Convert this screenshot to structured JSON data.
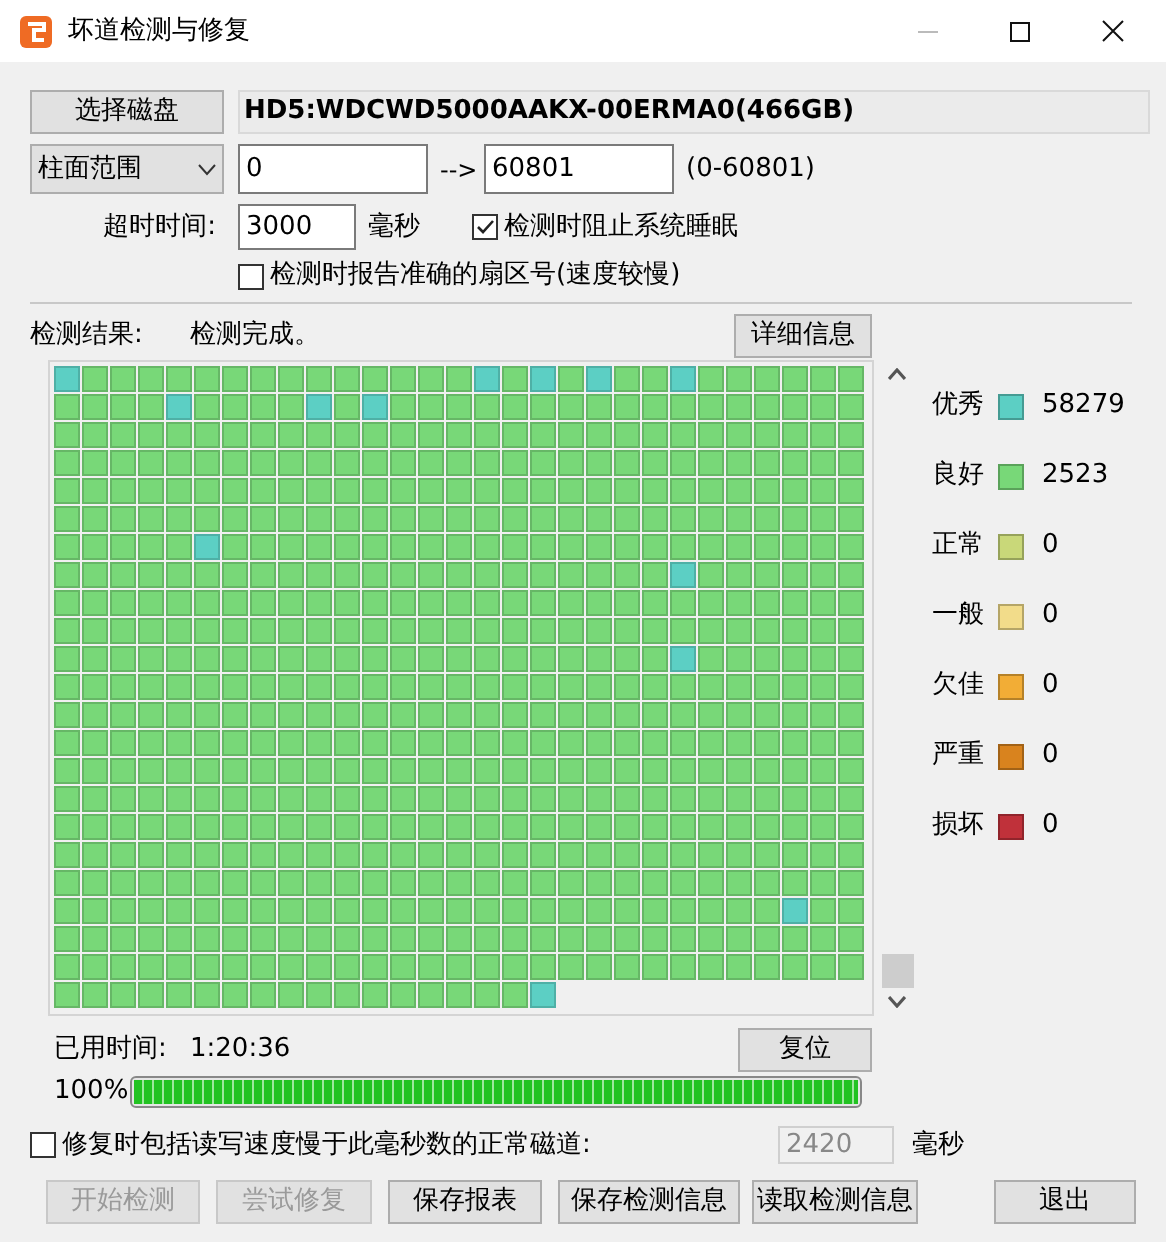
{
  "window": {
    "title": "坏道检测与修复"
  },
  "disk": {
    "button": "选择磁盘",
    "name": "HD5:WDCWD5000AAKX-00ERMA0(466GB)"
  },
  "range": {
    "mode": "柱面范围",
    "from": "0",
    "arrow": "-->",
    "to": "60801",
    "hint": "(0-60801)"
  },
  "timeout": {
    "label": "超时时间:",
    "value": "3000",
    "unit": "毫秒"
  },
  "options": [
    {
      "label": "检测时阻止系统睡眠",
      "checked": true
    },
    {
      "label": "检测时报告准确的扇区号(速度较慢)",
      "checked": false
    }
  ],
  "result": {
    "label": "检测结果:",
    "status": "检测完成。",
    "details_button": "详细信息"
  },
  "legend": [
    {
      "label": "优秀",
      "count": "58279",
      "color": "#5ccfc4"
    },
    {
      "label": "良好",
      "count": "2523",
      "color": "#78d878"
    },
    {
      "label": "正常",
      "count": "0",
      "color": "#c9d879"
    },
    {
      "label": "一般",
      "count": "0",
      "color": "#f2dc8a"
    },
    {
      "label": "欠佳",
      "count": "0",
      "color": "#f2ad36"
    },
    {
      "label": "严重",
      "count": "0",
      "color": "#d9831e"
    },
    {
      "label": "损坏",
      "count": "0",
      "color": "#c0313a"
    }
  ],
  "map_rows": [
    [
      {
        "color": "#5ccfc4"
      },
      {
        "color": "#78d878"
      },
      {
        "color": "#78d878"
      },
      {
        "color": "#78d878"
      },
      {
        "color": "#78d878"
      },
      {
        "color": "#78d878"
      },
      {
        "color": "#78d878"
      },
      {
        "color": "#78d878"
      },
      {
        "color": "#78d878"
      },
      {
        "color": "#78d878"
      },
      {
        "color": "#78d878"
      },
      {
        "color": "#78d878"
      },
      {
        "color": "#78d878"
      },
      {
        "color": "#78d878"
      },
      {
        "color": "#78d878"
      },
      {
        "color": "#5ccfc4"
      },
      {
        "color": "#78d878"
      },
      {
        "color": "#5ccfc4"
      },
      {
        "color": "#78d878"
      },
      {
        "color": "#5ccfc4"
      },
      {
        "color": "#78d878"
      },
      {
        "color": "#78d878"
      },
      {
        "color": "#5ccfc4"
      },
      {
        "color": "#78d878"
      },
      {
        "color": "#78d878"
      },
      {
        "color": "#78d878"
      },
      {
        "color": "#78d878"
      },
      {
        "color": "#78d878"
      },
      {
        "color": "#78d878"
      }
    ],
    [
      {
        "color": "#78d878"
      },
      {
        "color": "#78d878"
      },
      {
        "color": "#78d878"
      },
      {
        "color": "#78d878"
      },
      {
        "color": "#5ccfc4"
      },
      {
        "color": "#78d878"
      },
      {
        "color": "#78d878"
      },
      {
        "color": "#78d878"
      },
      {
        "color": "#78d878"
      },
      {
        "color": "#5ccfc4"
      },
      {
        "color": "#78d878"
      },
      {
        "color": "#5ccfc4"
      },
      {
        "color": "#78d878"
      },
      {
        "color": "#78d878"
      },
      {
        "color": "#78d878"
      },
      {
        "color": "#78d878"
      },
      {
        "color": "#78d878"
      },
      {
        "color": "#78d878"
      },
      {
        "color": "#78d878"
      },
      {
        "color": "#78d878"
      },
      {
        "color": "#78d878"
      },
      {
        "color": "#78d878"
      },
      {
        "color": "#78d878"
      },
      {
        "color": "#78d878"
      },
      {
        "color": "#78d878"
      },
      {
        "color": "#78d878"
      },
      {
        "color": "#78d878"
      },
      {
        "color": "#78d878"
      },
      {
        "color": "#78d878"
      }
    ],
    [
      {
        "color": "#78d878"
      },
      {
        "color": "#78d878"
      },
      {
        "color": "#78d878"
      },
      {
        "color": "#78d878"
      },
      {
        "color": "#78d878"
      },
      {
        "color": "#78d878"
      },
      {
        "color": "#78d878"
      },
      {
        "color": "#78d878"
      },
      {
        "color": "#78d878"
      },
      {
        "color": "#78d878"
      },
      {
        "color": "#78d878"
      },
      {
        "color": "#78d878"
      },
      {
        "color": "#78d878"
      },
      {
        "color": "#78d878"
      },
      {
        "color": "#78d878"
      },
      {
        "color": "#78d878"
      },
      {
        "color": "#78d878"
      },
      {
        "color": "#78d878"
      },
      {
        "color": "#78d878"
      },
      {
        "color": "#78d878"
      },
      {
        "color": "#78d878"
      },
      {
        "color": "#78d878"
      },
      {
        "color": "#78d878"
      },
      {
        "color": "#78d878"
      },
      {
        "color": "#78d878"
      },
      {
        "color": "#78d878"
      },
      {
        "color": "#78d878"
      },
      {
        "color": "#78d878"
      },
      {
        "color": "#78d878"
      }
    ],
    [
      {
        "color": "#78d878"
      },
      {
        "color": "#78d878"
      },
      {
        "color": "#78d878"
      },
      {
        "color": "#78d878"
      },
      {
        "color": "#78d878"
      },
      {
        "color": "#78d878"
      },
      {
        "color": "#78d878"
      },
      {
        "color": "#78d878"
      },
      {
        "color": "#78d878"
      },
      {
        "color": "#78d878"
      },
      {
        "color": "#78d878"
      },
      {
        "color": "#78d878"
      },
      {
        "color": "#78d878"
      },
      {
        "color": "#78d878"
      },
      {
        "color": "#78d878"
      },
      {
        "color": "#78d878"
      },
      {
        "color": "#78d878"
      },
      {
        "color": "#78d878"
      },
      {
        "color": "#78d878"
      },
      {
        "color": "#78d878"
      },
      {
        "color": "#78d878"
      },
      {
        "color": "#78d878"
      },
      {
        "color": "#78d878"
      },
      {
        "color": "#78d878"
      },
      {
        "color": "#78d878"
      },
      {
        "color": "#78d878"
      },
      {
        "color": "#78d878"
      },
      {
        "color": "#78d878"
      },
      {
        "color": "#78d878"
      }
    ],
    [
      {
        "color": "#78d878"
      },
      {
        "color": "#78d878"
      },
      {
        "color": "#78d878"
      },
      {
        "color": "#78d878"
      },
      {
        "color": "#78d878"
      },
      {
        "color": "#78d878"
      },
      {
        "color": "#78d878"
      },
      {
        "color": "#78d878"
      },
      {
        "color": "#78d878"
      },
      {
        "color": "#78d878"
      },
      {
        "color": "#78d878"
      },
      {
        "color": "#78d878"
      },
      {
        "color": "#78d878"
      },
      {
        "color": "#78d878"
      },
      {
        "color": "#78d878"
      },
      {
        "color": "#78d878"
      },
      {
        "color": "#78d878"
      },
      {
        "color": "#78d878"
      },
      {
        "color": "#78d878"
      },
      {
        "color": "#78d878"
      },
      {
        "color": "#78d878"
      },
      {
        "color": "#78d878"
      },
      {
        "color": "#78d878"
      },
      {
        "color": "#78d878"
      },
      {
        "color": "#78d878"
      },
      {
        "color": "#78d878"
      },
      {
        "color": "#78d878"
      },
      {
        "color": "#78d878"
      },
      {
        "color": "#78d878"
      }
    ],
    [
      {
        "color": "#78d878"
      },
      {
        "color": "#78d878"
      },
      {
        "color": "#78d878"
      },
      {
        "color": "#78d878"
      },
      {
        "color": "#78d878"
      },
      {
        "color": "#78d878"
      },
      {
        "color": "#78d878"
      },
      {
        "color": "#78d878"
      },
      {
        "color": "#78d878"
      },
      {
        "color": "#78d878"
      },
      {
        "color": "#78d878"
      },
      {
        "color": "#78d878"
      },
      {
        "color": "#78d878"
      },
      {
        "color": "#78d878"
      },
      {
        "color": "#78d878"
      },
      {
        "color": "#78d878"
      },
      {
        "color": "#78d878"
      },
      {
        "color": "#78d878"
      },
      {
        "color": "#78d878"
      },
      {
        "color": "#78d878"
      },
      {
        "color": "#78d878"
      },
      {
        "color": "#78d878"
      },
      {
        "color": "#78d878"
      },
      {
        "color": "#78d878"
      },
      {
        "color": "#78d878"
      },
      {
        "color": "#78d878"
      },
      {
        "color": "#78d878"
      },
      {
        "color": "#78d878"
      },
      {
        "color": "#78d878"
      }
    ],
    [
      {
        "color": "#78d878"
      },
      {
        "color": "#78d878"
      },
      {
        "color": "#78d878"
      },
      {
        "color": "#78d878"
      },
      {
        "color": "#78d878"
      },
      {
        "color": "#5ccfc4"
      },
      {
        "color": "#78d878"
      },
      {
        "color": "#78d878"
      },
      {
        "color": "#78d878"
      },
      {
        "color": "#78d878"
      },
      {
        "color": "#78d878"
      },
      {
        "color": "#78d878"
      },
      {
        "color": "#78d878"
      },
      {
        "color": "#78d878"
      },
      {
        "color": "#78d878"
      },
      {
        "color": "#78d878"
      },
      {
        "color": "#78d878"
      },
      {
        "color": "#78d878"
      },
      {
        "color": "#78d878"
      },
      {
        "color": "#78d878"
      },
      {
        "color": "#78d878"
      },
      {
        "color": "#78d878"
      },
      {
        "color": "#78d878"
      },
      {
        "color": "#78d878"
      },
      {
        "color": "#78d878"
      },
      {
        "color": "#78d878"
      },
      {
        "color": "#78d878"
      },
      {
        "color": "#78d878"
      },
      {
        "color": "#78d878"
      }
    ],
    [
      {
        "color": "#78d878"
      },
      {
        "color": "#78d878"
      },
      {
        "color": "#78d878"
      },
      {
        "color": "#78d878"
      },
      {
        "color": "#78d878"
      },
      {
        "color": "#78d878"
      },
      {
        "color": "#78d878"
      },
      {
        "color": "#78d878"
      },
      {
        "color": "#78d878"
      },
      {
        "color": "#78d878"
      },
      {
        "color": "#78d878"
      },
      {
        "color": "#78d878"
      },
      {
        "color": "#78d878"
      },
      {
        "color": "#78d878"
      },
      {
        "color": "#78d878"
      },
      {
        "color": "#78d878"
      },
      {
        "color": "#78d878"
      },
      {
        "color": "#78d878"
      },
      {
        "color": "#78d878"
      },
      {
        "color": "#78d878"
      },
      {
        "color": "#78d878"
      },
      {
        "color": "#78d878"
      },
      {
        "color": "#5ccfc4"
      },
      {
        "color": "#78d878"
      },
      {
        "color": "#78d878"
      },
      {
        "color": "#78d878"
      },
      {
        "color": "#78d878"
      },
      {
        "color": "#78d878"
      },
      {
        "color": "#78d878"
      }
    ],
    [
      {
        "color": "#78d878"
      },
      {
        "color": "#78d878"
      },
      {
        "color": "#78d878"
      },
      {
        "color": "#78d878"
      },
      {
        "color": "#78d878"
      },
      {
        "color": "#78d878"
      },
      {
        "color": "#78d878"
      },
      {
        "color": "#78d878"
      },
      {
        "color": "#78d878"
      },
      {
        "color": "#78d878"
      },
      {
        "color": "#78d878"
      },
      {
        "color": "#78d878"
      },
      {
        "color": "#78d878"
      },
      {
        "color": "#78d878"
      },
      {
        "color": "#78d878"
      },
      {
        "color": "#78d878"
      },
      {
        "color": "#78d878"
      },
      {
        "color": "#78d878"
      },
      {
        "color": "#78d878"
      },
      {
        "color": "#78d878"
      },
      {
        "color": "#78d878"
      },
      {
        "color": "#78d878"
      },
      {
        "color": "#78d878"
      },
      {
        "color": "#78d878"
      },
      {
        "color": "#78d878"
      },
      {
        "color": "#78d878"
      },
      {
        "color": "#78d878"
      },
      {
        "color": "#78d878"
      },
      {
        "color": "#78d878"
      }
    ],
    [
      {
        "color": "#78d878"
      },
      {
        "color": "#78d878"
      },
      {
        "color": "#78d878"
      },
      {
        "color": "#78d878"
      },
      {
        "color": "#78d878"
      },
      {
        "color": "#78d878"
      },
      {
        "color": "#78d878"
      },
      {
        "color": "#78d878"
      },
      {
        "color": "#78d878"
      },
      {
        "color": "#78d878"
      },
      {
        "color": "#78d878"
      },
      {
        "color": "#78d878"
      },
      {
        "color": "#78d878"
      },
      {
        "color": "#78d878"
      },
      {
        "color": "#78d878"
      },
      {
        "color": "#78d878"
      },
      {
        "color": "#78d878"
      },
      {
        "color": "#78d878"
      },
      {
        "color": "#78d878"
      },
      {
        "color": "#78d878"
      },
      {
        "color": "#78d878"
      },
      {
        "color": "#78d878"
      },
      {
        "color": "#78d878"
      },
      {
        "color": "#78d878"
      },
      {
        "color": "#78d878"
      },
      {
        "color": "#78d878"
      },
      {
        "color": "#78d878"
      },
      {
        "color": "#78d878"
      },
      {
        "color": "#78d878"
      }
    ],
    [
      {
        "color": "#78d878"
      },
      {
        "color": "#78d878"
      },
      {
        "color": "#78d878"
      },
      {
        "color": "#78d878"
      },
      {
        "color": "#78d878"
      },
      {
        "color": "#78d878"
      },
      {
        "color": "#78d878"
      },
      {
        "color": "#78d878"
      },
      {
        "color": "#78d878"
      },
      {
        "color": "#78d878"
      },
      {
        "color": "#78d878"
      },
      {
        "color": "#78d878"
      },
      {
        "color": "#78d878"
      },
      {
        "color": "#78d878"
      },
      {
        "color": "#78d878"
      },
      {
        "color": "#78d878"
      },
      {
        "color": "#78d878"
      },
      {
        "color": "#78d878"
      },
      {
        "color": "#78d878"
      },
      {
        "color": "#78d878"
      },
      {
        "color": "#78d878"
      },
      {
        "color": "#78d878"
      },
      {
        "color": "#5ccfc4"
      },
      {
        "color": "#78d878"
      },
      {
        "color": "#78d878"
      },
      {
        "color": "#78d878"
      },
      {
        "color": "#78d878"
      },
      {
        "color": "#78d878"
      },
      {
        "color": "#78d878"
      }
    ],
    [
      {
        "color": "#78d878"
      },
      {
        "color": "#78d878"
      },
      {
        "color": "#78d878"
      },
      {
        "color": "#78d878"
      },
      {
        "color": "#78d878"
      },
      {
        "color": "#78d878"
      },
      {
        "color": "#78d878"
      },
      {
        "color": "#78d878"
      },
      {
        "color": "#78d878"
      },
      {
        "color": "#78d878"
      },
      {
        "color": "#78d878"
      },
      {
        "color": "#78d878"
      },
      {
        "color": "#78d878"
      },
      {
        "color": "#78d878"
      },
      {
        "color": "#78d878"
      },
      {
        "color": "#78d878"
      },
      {
        "color": "#78d878"
      },
      {
        "color": "#78d878"
      },
      {
        "color": "#78d878"
      },
      {
        "color": "#78d878"
      },
      {
        "color": "#78d878"
      },
      {
        "color": "#78d878"
      },
      {
        "color": "#78d878"
      },
      {
        "color": "#78d878"
      },
      {
        "color": "#78d878"
      },
      {
        "color": "#78d878"
      },
      {
        "color": "#78d878"
      },
      {
        "color": "#78d878"
      },
      {
        "color": "#78d878"
      }
    ],
    [
      {
        "color": "#78d878"
      },
      {
        "color": "#78d878"
      },
      {
        "color": "#78d878"
      },
      {
        "color": "#78d878"
      },
      {
        "color": "#78d878"
      },
      {
        "color": "#78d878"
      },
      {
        "color": "#78d878"
      },
      {
        "color": "#78d878"
      },
      {
        "color": "#78d878"
      },
      {
        "color": "#78d878"
      },
      {
        "color": "#78d878"
      },
      {
        "color": "#78d878"
      },
      {
        "color": "#78d878"
      },
      {
        "color": "#78d878"
      },
      {
        "color": "#78d878"
      },
      {
        "color": "#78d878"
      },
      {
        "color": "#78d878"
      },
      {
        "color": "#78d878"
      },
      {
        "color": "#78d878"
      },
      {
        "color": "#78d878"
      },
      {
        "color": "#78d878"
      },
      {
        "color": "#78d878"
      },
      {
        "color": "#78d878"
      },
      {
        "color": "#78d878"
      },
      {
        "color": "#78d878"
      },
      {
        "color": "#78d878"
      },
      {
        "color": "#78d878"
      },
      {
        "color": "#78d878"
      },
      {
        "color": "#78d878"
      }
    ],
    [
      {
        "color": "#78d878"
      },
      {
        "color": "#78d878"
      },
      {
        "color": "#78d878"
      },
      {
        "color": "#78d878"
      },
      {
        "color": "#78d878"
      },
      {
        "color": "#78d878"
      },
      {
        "color": "#78d878"
      },
      {
        "color": "#78d878"
      },
      {
        "color": "#78d878"
      },
      {
        "color": "#78d878"
      },
      {
        "color": "#78d878"
      },
      {
        "color": "#78d878"
      },
      {
        "color": "#78d878"
      },
      {
        "color": "#78d878"
      },
      {
        "color": "#78d878"
      },
      {
        "color": "#78d878"
      },
      {
        "color": "#78d878"
      },
      {
        "color": "#78d878"
      },
      {
        "color": "#78d878"
      },
      {
        "color": "#78d878"
      },
      {
        "color": "#78d878"
      },
      {
        "color": "#78d878"
      },
      {
        "color": "#78d878"
      },
      {
        "color": "#78d878"
      },
      {
        "color": "#78d878"
      },
      {
        "color": "#78d878"
      },
      {
        "color": "#78d878"
      },
      {
        "color": "#78d878"
      },
      {
        "color": "#78d878"
      }
    ],
    [
      {
        "color": "#78d878"
      },
      {
        "color": "#78d878"
      },
      {
        "color": "#78d878"
      },
      {
        "color": "#78d878"
      },
      {
        "color": "#78d878"
      },
      {
        "color": "#78d878"
      },
      {
        "color": "#78d878"
      },
      {
        "color": "#78d878"
      },
      {
        "color": "#78d878"
      },
      {
        "color": "#78d878"
      },
      {
        "color": "#78d878"
      },
      {
        "color": "#78d878"
      },
      {
        "color": "#78d878"
      },
      {
        "color": "#78d878"
      },
      {
        "color": "#78d878"
      },
      {
        "color": "#78d878"
      },
      {
        "color": "#78d878"
      },
      {
        "color": "#78d878"
      },
      {
        "color": "#78d878"
      },
      {
        "color": "#78d878"
      },
      {
        "color": "#78d878"
      },
      {
        "color": "#78d878"
      },
      {
        "color": "#78d878"
      },
      {
        "color": "#78d878"
      },
      {
        "color": "#78d878"
      },
      {
        "color": "#78d878"
      },
      {
        "color": "#78d878"
      },
      {
        "color": "#78d878"
      },
      {
        "color": "#78d878"
      }
    ],
    [
      {
        "color": "#78d878"
      },
      {
        "color": "#78d878"
      },
      {
        "color": "#78d878"
      },
      {
        "color": "#78d878"
      },
      {
        "color": "#78d878"
      },
      {
        "color": "#78d878"
      },
      {
        "color": "#78d878"
      },
      {
        "color": "#78d878"
      },
      {
        "color": "#78d878"
      },
      {
        "color": "#78d878"
      },
      {
        "color": "#78d878"
      },
      {
        "color": "#78d878"
      },
      {
        "color": "#78d878"
      },
      {
        "color": "#78d878"
      },
      {
        "color": "#78d878"
      },
      {
        "color": "#78d878"
      },
      {
        "color": "#78d878"
      },
      {
        "color": "#78d878"
      },
      {
        "color": "#78d878"
      },
      {
        "color": "#78d878"
      },
      {
        "color": "#78d878"
      },
      {
        "color": "#78d878"
      },
      {
        "color": "#78d878"
      },
      {
        "color": "#78d878"
      },
      {
        "color": "#78d878"
      },
      {
        "color": "#78d878"
      },
      {
        "color": "#78d878"
      },
      {
        "color": "#78d878"
      },
      {
        "color": "#78d878"
      }
    ],
    [
      {
        "color": "#78d878"
      },
      {
        "color": "#78d878"
      },
      {
        "color": "#78d878"
      },
      {
        "color": "#78d878"
      },
      {
        "color": "#78d878"
      },
      {
        "color": "#78d878"
      },
      {
        "color": "#78d878"
      },
      {
        "color": "#78d878"
      },
      {
        "color": "#78d878"
      },
      {
        "color": "#78d878"
      },
      {
        "color": "#78d878"
      },
      {
        "color": "#78d878"
      },
      {
        "color": "#78d878"
      },
      {
        "color": "#78d878"
      },
      {
        "color": "#78d878"
      },
      {
        "color": "#78d878"
      },
      {
        "color": "#78d878"
      },
      {
        "color": "#78d878"
      },
      {
        "color": "#78d878"
      },
      {
        "color": "#78d878"
      },
      {
        "color": "#78d878"
      },
      {
        "color": "#78d878"
      },
      {
        "color": "#78d878"
      },
      {
        "color": "#78d878"
      },
      {
        "color": "#78d878"
      },
      {
        "color": "#78d878"
      },
      {
        "color": "#78d878"
      },
      {
        "color": "#78d878"
      },
      {
        "color": "#78d878"
      }
    ],
    [
      {
        "color": "#78d878"
      },
      {
        "color": "#78d878"
      },
      {
        "color": "#78d878"
      },
      {
        "color": "#78d878"
      },
      {
        "color": "#78d878"
      },
      {
        "color": "#78d878"
      },
      {
        "color": "#78d878"
      },
      {
        "color": "#78d878"
      },
      {
        "color": "#78d878"
      },
      {
        "color": "#78d878"
      },
      {
        "color": "#78d878"
      },
      {
        "color": "#78d878"
      },
      {
        "color": "#78d878"
      },
      {
        "color": "#78d878"
      },
      {
        "color": "#78d878"
      },
      {
        "color": "#78d878"
      },
      {
        "color": "#78d878"
      },
      {
        "color": "#78d878"
      },
      {
        "color": "#78d878"
      },
      {
        "color": "#78d878"
      },
      {
        "color": "#78d878"
      },
      {
        "color": "#78d878"
      },
      {
        "color": "#78d878"
      },
      {
        "color": "#78d878"
      },
      {
        "color": "#78d878"
      },
      {
        "color": "#78d878"
      },
      {
        "color": "#78d878"
      },
      {
        "color": "#78d878"
      },
      {
        "color": "#78d878"
      }
    ],
    [
      {
        "color": "#78d878"
      },
      {
        "color": "#78d878"
      },
      {
        "color": "#78d878"
      },
      {
        "color": "#78d878"
      },
      {
        "color": "#78d878"
      },
      {
        "color": "#78d878"
      },
      {
        "color": "#78d878"
      },
      {
        "color": "#78d878"
      },
      {
        "color": "#78d878"
      },
      {
        "color": "#78d878"
      },
      {
        "color": "#78d878"
      },
      {
        "color": "#78d878"
      },
      {
        "color": "#78d878"
      },
      {
        "color": "#78d878"
      },
      {
        "color": "#78d878"
      },
      {
        "color": "#78d878"
      },
      {
        "color": "#78d878"
      },
      {
        "color": "#78d878"
      },
      {
        "color": "#78d878"
      },
      {
        "color": "#78d878"
      },
      {
        "color": "#78d878"
      },
      {
        "color": "#78d878"
      },
      {
        "color": "#78d878"
      },
      {
        "color": "#78d878"
      },
      {
        "color": "#78d878"
      },
      {
        "color": "#78d878"
      },
      {
        "color": "#78d878"
      },
      {
        "color": "#78d878"
      },
      {
        "color": "#78d878"
      }
    ],
    [
      {
        "color": "#78d878"
      },
      {
        "color": "#78d878"
      },
      {
        "color": "#78d878"
      },
      {
        "color": "#78d878"
      },
      {
        "color": "#78d878"
      },
      {
        "color": "#78d878"
      },
      {
        "color": "#78d878"
      },
      {
        "color": "#78d878"
      },
      {
        "color": "#78d878"
      },
      {
        "color": "#78d878"
      },
      {
        "color": "#78d878"
      },
      {
        "color": "#78d878"
      },
      {
        "color": "#78d878"
      },
      {
        "color": "#78d878"
      },
      {
        "color": "#78d878"
      },
      {
        "color": "#78d878"
      },
      {
        "color": "#78d878"
      },
      {
        "color": "#78d878"
      },
      {
        "color": "#78d878"
      },
      {
        "color": "#78d878"
      },
      {
        "color": "#78d878"
      },
      {
        "color": "#78d878"
      },
      {
        "color": "#78d878"
      },
      {
        "color": "#78d878"
      },
      {
        "color": "#78d878"
      },
      {
        "color": "#78d878"
      },
      {
        "color": "#5ccfc4"
      },
      {
        "color": "#78d878"
      },
      {
        "color": "#78d878"
      }
    ],
    [
      {
        "color": "#78d878"
      },
      {
        "color": "#78d878"
      },
      {
        "color": "#78d878"
      },
      {
        "color": "#78d878"
      },
      {
        "color": "#78d878"
      },
      {
        "color": "#78d878"
      },
      {
        "color": "#78d878"
      },
      {
        "color": "#78d878"
      },
      {
        "color": "#78d878"
      },
      {
        "color": "#78d878"
      },
      {
        "color": "#78d878"
      },
      {
        "color": "#78d878"
      },
      {
        "color": "#78d878"
      },
      {
        "color": "#78d878"
      },
      {
        "color": "#78d878"
      },
      {
        "color": "#78d878"
      },
      {
        "color": "#78d878"
      },
      {
        "color": "#78d878"
      },
      {
        "color": "#78d878"
      },
      {
        "color": "#78d878"
      },
      {
        "color": "#78d878"
      },
      {
        "color": "#78d878"
      },
      {
        "color": "#78d878"
      },
      {
        "color": "#78d878"
      },
      {
        "color": "#78d878"
      },
      {
        "color": "#78d878"
      },
      {
        "color": "#78d878"
      },
      {
        "color": "#78d878"
      },
      {
        "color": "#78d878"
      }
    ],
    [
      {
        "color": "#78d878"
      },
      {
        "color": "#78d878"
      },
      {
        "color": "#78d878"
      },
      {
        "color": "#78d878"
      },
      {
        "color": "#78d878"
      },
      {
        "color": "#78d878"
      },
      {
        "color": "#78d878"
      },
      {
        "color": "#78d878"
      },
      {
        "color": "#78d878"
      },
      {
        "color": "#78d878"
      },
      {
        "color": "#78d878"
      },
      {
        "color": "#78d878"
      },
      {
        "color": "#78d878"
      },
      {
        "color": "#78d878"
      },
      {
        "color": "#78d878"
      },
      {
        "color": "#78d878"
      },
      {
        "color": "#78d878"
      },
      {
        "color": "#78d878"
      },
      {
        "color": "#78d878"
      },
      {
        "color": "#78d878"
      },
      {
        "color": "#78d878"
      },
      {
        "color": "#78d878"
      },
      {
        "color": "#78d878"
      },
      {
        "color": "#78d878"
      },
      {
        "color": "#78d878"
      },
      {
        "color": "#78d878"
      },
      {
        "color": "#78d878"
      },
      {
        "color": "#78d878"
      },
      {
        "color": "#78d878"
      }
    ],
    [
      {
        "color": "#78d878"
      },
      {
        "color": "#78d878"
      },
      {
        "color": "#78d878"
      },
      {
        "color": "#78d878"
      },
      {
        "color": "#78d878"
      },
      {
        "color": "#78d878"
      },
      {
        "color": "#78d878"
      },
      {
        "color": "#78d878"
      },
      {
        "color": "#78d878"
      },
      {
        "color": "#78d878"
      },
      {
        "color": "#78d878"
      },
      {
        "color": "#78d878"
      },
      {
        "color": "#78d878"
      },
      {
        "color": "#78d878"
      },
      {
        "color": "#78d878"
      },
      {
        "color": "#78d878"
      },
      {
        "color": "#78d878"
      },
      {
        "color": "#5ccfc4"
      }
    ]
  ],
  "elapsed": {
    "label": "已用时间:",
    "value": "1:20:36",
    "reset_button": "复位"
  },
  "progress": {
    "percent": "100%",
    "level": 1
  },
  "repair_option": {
    "label": "修复时包括读写速度慢于此毫秒数的正常磁道:",
    "checked": false,
    "value": "2420",
    "field_disabled": true,
    "unit": "毫秒"
  },
  "buttons": [
    {
      "label": "开始检测",
      "disabled": true
    },
    {
      "label": "尝试修复",
      "disabled": true
    },
    {
      "label": "保存报表",
      "disabled": false
    },
    {
      "label": "保存检测信息",
      "disabled": false
    },
    {
      "label": "读取检测信息",
      "disabled": false
    },
    {
      "label": "退出",
      "disabled": false
    }
  ]
}
